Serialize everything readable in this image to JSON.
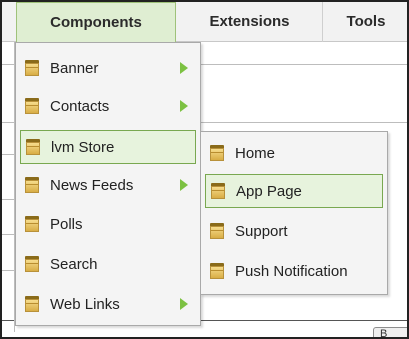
{
  "menubar": {
    "items": [
      {
        "label": "Components"
      },
      {
        "label": "Extensions"
      },
      {
        "label": "Tools"
      }
    ]
  },
  "menu1": {
    "items": [
      {
        "label": "Banner"
      },
      {
        "label": "Contacts"
      },
      {
        "label": "lvm Store"
      },
      {
        "label": "News Feeds"
      },
      {
        "label": "Polls"
      },
      {
        "label": "Search"
      },
      {
        "label": "Web Links"
      }
    ]
  },
  "menu2": {
    "items": [
      {
        "label": "Home"
      },
      {
        "label": "App Page"
      },
      {
        "label": "Support"
      },
      {
        "label": "Push Notification"
      }
    ]
  },
  "bottom_button": {
    "label": "B"
  },
  "colors": {
    "accent_green": "#7cc142",
    "active_border": "#79a850"
  }
}
